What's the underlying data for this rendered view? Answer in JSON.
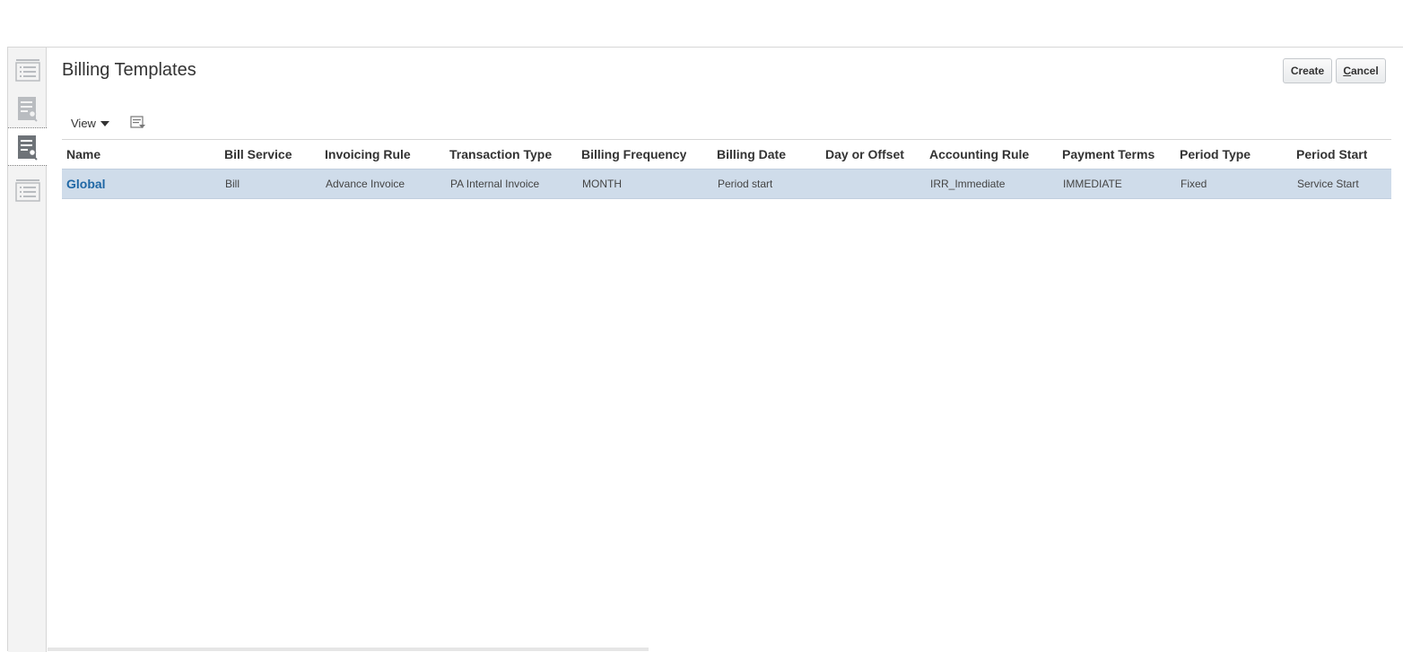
{
  "page": {
    "title": "Billing Templates"
  },
  "actions": {
    "create_label": "Create",
    "cancel_label_first": "C",
    "cancel_label_rest": "ancel"
  },
  "toolbar": {
    "view_label": "View"
  },
  "rail": {
    "icons": [
      "list-icon",
      "edit-list-icon",
      "edit-list-icon-active",
      "list-icon"
    ]
  },
  "table": {
    "columns": [
      "Name",
      "Bill Service",
      "Invoicing Rule",
      "Transaction Type",
      "Billing Frequency",
      "Billing Date",
      "Day or Offset",
      "Accounting Rule",
      "Payment Terms",
      "Period Type",
      "Period Start"
    ],
    "rows": [
      {
        "name": "Global",
        "bill_service": "Bill",
        "invoicing_rule": "Advance Invoice",
        "transaction_type": "PA Internal Invoice",
        "billing_frequency": "MONTH",
        "billing_date": "Period start",
        "day_or_offset": "",
        "accounting_rule": "IRR_Immediate",
        "payment_terms": "IMMEDIATE",
        "period_type": "Fixed",
        "period_start": "Service Start"
      }
    ]
  },
  "colors": {
    "selected_row": "#cfdcea",
    "link": "#1f67a5",
    "rail_bg": "#f3f3f3"
  }
}
